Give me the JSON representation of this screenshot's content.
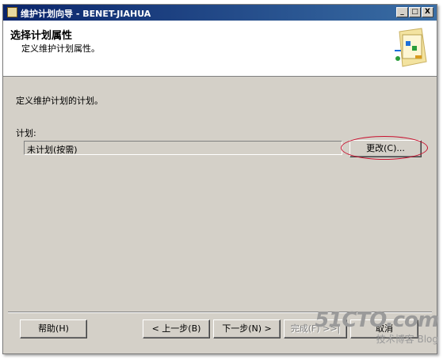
{
  "window": {
    "title": "维护计划向导 - BENET-JIAHUA",
    "min": "_",
    "max": "□",
    "close": "X"
  },
  "header": {
    "title": "选择计划属性",
    "subtitle": "定义维护计划属性。"
  },
  "body": {
    "instruction": "定义维护计划的计划。",
    "plan_label": "计划:",
    "plan_value": "未计划(按需)",
    "change_button": "更改(C)..."
  },
  "footer": {
    "help": "帮助(H)",
    "back": "< 上一步(B)",
    "next": "下一步(N) >",
    "finish": "完成(F) >>|",
    "cancel": "取消"
  },
  "watermark": {
    "site": "51CTO.com",
    "text": "技术博客",
    "blog": "Blog"
  },
  "colors": {
    "titlebar_start": "#0a246a",
    "titlebar_end": "#3a6ea5",
    "dialog_bg": "#d4d0c8",
    "highlight": "#c8102e"
  },
  "icons": [
    "app-icon",
    "wizard-graphic-icon"
  ]
}
